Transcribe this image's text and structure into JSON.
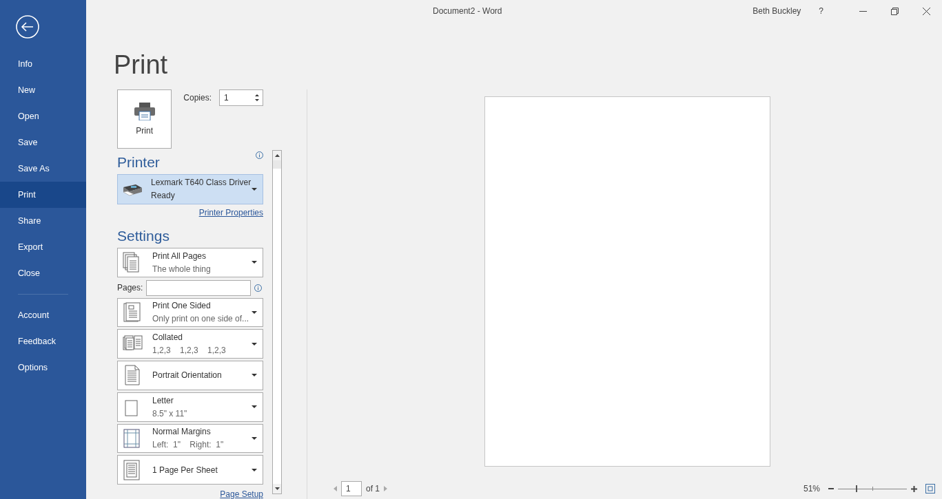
{
  "window": {
    "title": "Document2 - Word",
    "user": "Beth Buckley",
    "help": "?"
  },
  "sidebar": {
    "items": [
      {
        "label": "Info",
        "selected": false
      },
      {
        "label": "New",
        "selected": false
      },
      {
        "label": "Open",
        "selected": false
      },
      {
        "label": "Save",
        "selected": false
      },
      {
        "label": "Save As",
        "selected": false
      },
      {
        "label": "Print",
        "selected": true
      },
      {
        "label": "Share",
        "selected": false
      },
      {
        "label": "Export",
        "selected": false
      },
      {
        "label": "Close",
        "selected": false
      }
    ],
    "bottom_items": [
      {
        "label": "Account",
        "selected": false
      },
      {
        "label": "Feedback",
        "selected": false
      },
      {
        "label": "Options",
        "selected": false
      }
    ]
  },
  "heading": "Print",
  "print_button": "Print",
  "copies": {
    "label": "Copies:",
    "value": "1"
  },
  "printer": {
    "heading": "Printer",
    "name": "Lexmark T640 Class Driver",
    "status": "Ready",
    "link": "Printer Properties"
  },
  "settings": {
    "heading": "Settings",
    "pages_label": "Pages:",
    "link": "Page Setup",
    "options": [
      {
        "kind": "pages",
        "title": "Print All Pages",
        "subtitle": "The whole thing"
      },
      {
        "kind": "sided",
        "title": "Print One Sided",
        "subtitle": "Only print on one side of..."
      },
      {
        "kind": "collated",
        "title": "Collated",
        "subtitle": "1,2,3    1,2,3    1,2,3"
      },
      {
        "kind": "portrait",
        "title": "Portrait Orientation"
      },
      {
        "kind": "letter",
        "title": "Letter",
        "subtitle": "8.5\" x 11\""
      },
      {
        "kind": "margins",
        "title": "Normal Margins",
        "subtitle": "Left:  1\"    Right:  1\""
      },
      {
        "kind": "sheet",
        "title": "1 Page Per Sheet"
      }
    ]
  },
  "preview": {
    "page_value": "1",
    "page_total": "of 1",
    "zoom": "51%",
    "zoom_slider": {
      "level": 0.27
    }
  }
}
